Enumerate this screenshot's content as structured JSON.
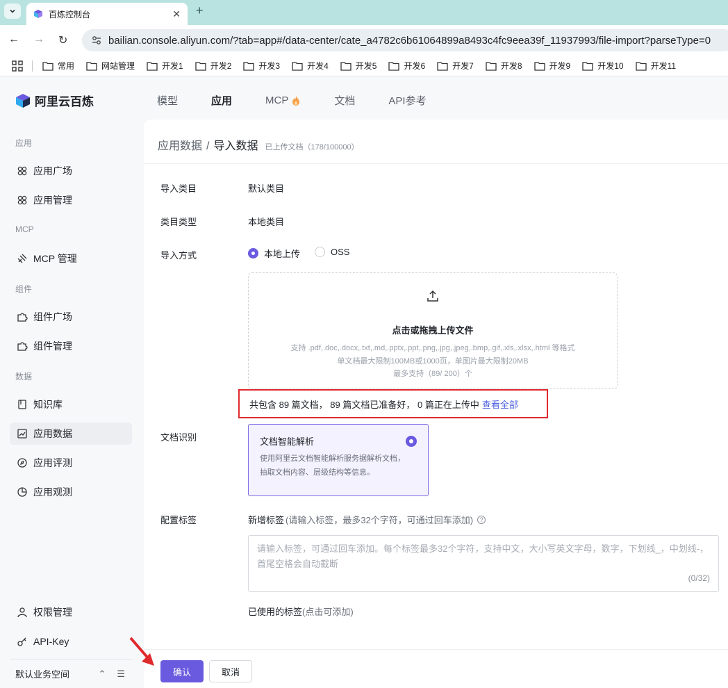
{
  "browser": {
    "tab_title": "百炼控制台",
    "url": "bailian.console.aliyun.com/?tab=app#/data-center/cate_a4782c6b61064899a8493c4fc9eea39f_11937993/file-import?parseType=0",
    "bookmarks": [
      "常用",
      "网站管理",
      "开发1",
      "开发2",
      "开发3",
      "开发4",
      "开发5",
      "开发6",
      "开发7",
      "开发8",
      "开发9",
      "开发10",
      "开发11"
    ]
  },
  "app": {
    "brand": "阿里云百炼",
    "topnav": [
      "模型",
      "应用",
      "MCP",
      "文档",
      "API参考"
    ],
    "topnav_active": "应用"
  },
  "sidebar": {
    "groups": {
      "app": "应用",
      "mcp": "MCP",
      "component": "组件",
      "data": "数据"
    },
    "items": {
      "app_square": "应用广场",
      "app_manage": "应用管理",
      "mcp_manage": "MCP 管理",
      "comp_square": "组件广场",
      "comp_manage": "组件管理",
      "knowledge": "知识库",
      "app_data": "应用数据",
      "app_eval": "应用评测",
      "app_observe": "应用观测",
      "permission": "权限管理",
      "api_key": "API-Key"
    },
    "workspace": "默认业务空间"
  },
  "page": {
    "crumb_parent": "应用数据",
    "crumb_sep": "/",
    "crumb_current": "导入数据",
    "uploaded_count": "已上传文档（178/100000）",
    "fields": {
      "category_label": "导入类目",
      "category_value": "默认类目",
      "type_label": "类目类型",
      "type_value": "本地类目",
      "method_label": "导入方式",
      "method_local": "本地上传",
      "method_oss": "OSS",
      "recog_label": "文档识别",
      "tags_label": "配置标签"
    },
    "upload": {
      "title": "点击或拖拽上传文件",
      "formats": "支持 .pdf,.doc,.docx,.txt,.md,.pptx,.ppt,.png,.jpg,.jpeg,.bmp,.gif,.xls,.xlsx,.html 等格式",
      "limits": "单文档最大限制100MB或1000页，单图片最大限制20MB",
      "max": "最多支持（89/ 200）个"
    },
    "status": {
      "text": "共包含 89 篇文档， 89 篇文档已准备好， 0 篇正在上传中",
      "link": "查看全部"
    },
    "recog_card": {
      "title": "文档智能解析",
      "desc": "使用阿里云文档智能解析服务据解析文档，抽取文档内容、层级结构等信息。"
    },
    "tags": {
      "head": "新增标签",
      "head_hint": "(请输入标签，最多32个字符，可通过回车添加)",
      "placeholder": "请输入标签，可通过回车添加。每个标签最多32个字符，支持中文，大小写英文字母，数字，下划线_，中划线-，首尾空格会自动截断",
      "count": "(0/32)",
      "used": "已使用的标签",
      "used_hint": "(点击可添加)"
    },
    "buttons": {
      "ok": "确认",
      "cancel": "取消"
    }
  },
  "colors": {
    "accent": "#6a5ae0",
    "highlight": "#e0292c",
    "link": "#4b5fe0"
  }
}
